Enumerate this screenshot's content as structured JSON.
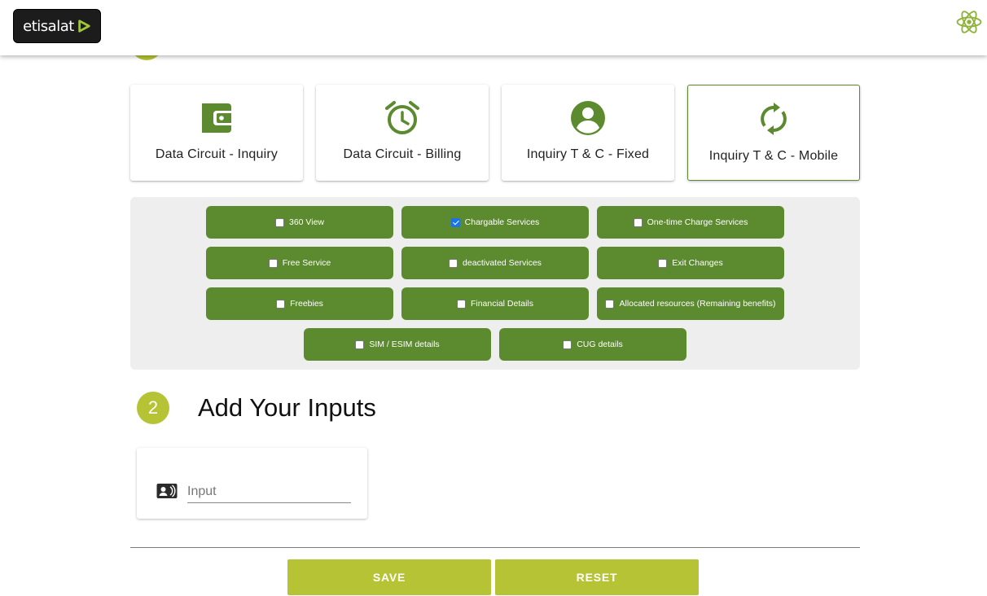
{
  "header": {
    "logo_text": "etisalat"
  },
  "cards": [
    {
      "label": "Data Circuit - Inquiry",
      "icon": "wallet-icon"
    },
    {
      "label": "Data Circuit - Billing",
      "icon": "alarm-clock-icon"
    },
    {
      "label": "Inquiry T & C - Fixed",
      "icon": "account-circle-icon"
    },
    {
      "label": "Inquiry T & C - Mobile",
      "icon": "sync-icon",
      "active": true
    }
  ],
  "options": [
    {
      "label": "360 View",
      "checked": false
    },
    {
      "label": "Chargable Services",
      "checked": true
    },
    {
      "label": "One-time Charge Services",
      "checked": false
    },
    {
      "label": "Free Service",
      "checked": false
    },
    {
      "label": "deactivated Services",
      "checked": false
    },
    {
      "label": "Exit Changes",
      "checked": false
    },
    {
      "label": "Freebies",
      "checked": false
    },
    {
      "label": "Financial Details",
      "checked": false
    },
    {
      "label": "Allocated resources (Remaining benefits)",
      "checked": false
    },
    {
      "label": "SIM / ESIM details",
      "checked": false
    },
    {
      "label": "CUG details",
      "checked": false
    }
  ],
  "step2": {
    "number": "2",
    "title": "Add Your Inputs"
  },
  "input": {
    "placeholder": "Input",
    "value": "",
    "icon": "contact-card-icon"
  },
  "buttons": {
    "save": "SAVE",
    "reset": "RESET"
  },
  "colors": {
    "primary_green": "#5c8a2e",
    "accent_lime": "#b5c335",
    "panel_bg": "#eeeeee"
  }
}
